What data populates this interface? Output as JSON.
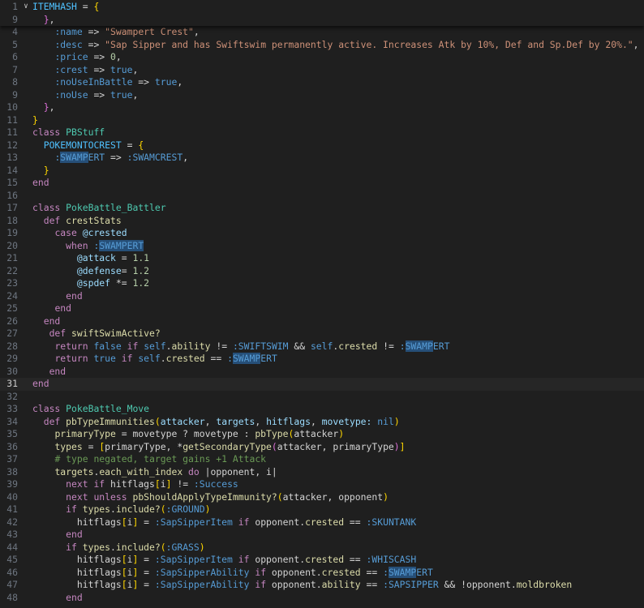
{
  "lines": [
    {
      "num": "1",
      "fold": true,
      "tokens": [
        [
          "t-const",
          "ITEMHASH"
        ],
        [
          "t-op",
          " = "
        ],
        [
          "t-br1",
          "{"
        ]
      ]
    },
    {
      "num": "9",
      "tokens": [
        [
          "t-op",
          "  "
        ],
        [
          "t-br2",
          "}"
        ],
        [
          "t-op",
          ","
        ]
      ]
    },
    {
      "num": "4",
      "tokens": [
        [
          "t-op",
          "    "
        ],
        [
          "t-sym",
          ":name"
        ],
        [
          "t-op",
          " => "
        ],
        [
          "t-str",
          "\"Swampert Crest\""
        ],
        [
          "t-op",
          ","
        ]
      ]
    },
    {
      "num": "5",
      "tokens": [
        [
          "t-op",
          "    "
        ],
        [
          "t-sym",
          ":desc"
        ],
        [
          "t-op",
          " => "
        ],
        [
          "t-str",
          "\"Sap Sipper and has Swiftswim permanently active. Increases Atk by 10%, Def and Sp.Def by 20%.\""
        ],
        [
          "t-op",
          ","
        ]
      ]
    },
    {
      "num": "6",
      "tokens": [
        [
          "t-op",
          "    "
        ],
        [
          "t-sym",
          ":price"
        ],
        [
          "t-op",
          " => "
        ],
        [
          "t-num",
          "0"
        ],
        [
          "t-op",
          ","
        ]
      ]
    },
    {
      "num": "7",
      "tokens": [
        [
          "t-op",
          "    "
        ],
        [
          "t-sym",
          ":crest"
        ],
        [
          "t-op",
          " => "
        ],
        [
          "t-sym",
          "true"
        ],
        [
          "t-op",
          ","
        ]
      ]
    },
    {
      "num": "8",
      "tokens": [
        [
          "t-op",
          "    "
        ],
        [
          "t-sym",
          ":noUseInBattle"
        ],
        [
          "t-op",
          " => "
        ],
        [
          "t-sym",
          "true"
        ],
        [
          "t-op",
          ","
        ]
      ]
    },
    {
      "num": "9",
      "tokens": [
        [
          "t-op",
          "    "
        ],
        [
          "t-sym",
          ":noUse"
        ],
        [
          "t-op",
          " => "
        ],
        [
          "t-sym",
          "true"
        ],
        [
          "t-op",
          ","
        ]
      ]
    },
    {
      "num": "10",
      "tokens": [
        [
          "t-op",
          "  "
        ],
        [
          "t-br2",
          "}"
        ],
        [
          "t-op",
          ","
        ]
      ]
    },
    {
      "num": "11",
      "tokens": [
        [
          "t-br1",
          "}"
        ]
      ]
    },
    {
      "num": "11",
      "tokens": [
        [
          "t-kw",
          "class"
        ],
        [
          "t-op",
          " "
        ],
        [
          "t-cls",
          "PBStuff"
        ]
      ]
    },
    {
      "num": "12",
      "tokens": [
        [
          "t-op",
          "  "
        ],
        [
          "t-const",
          "POKEMONTOCREST"
        ],
        [
          "t-op",
          " = "
        ],
        [
          "t-br1",
          "{"
        ]
      ]
    },
    {
      "num": "13",
      "tokens": [
        [
          "t-op",
          "    "
        ],
        [
          "t-sym",
          ":"
        ],
        [
          "t-sym hl",
          "SWAMP"
        ],
        [
          "t-sym",
          "ERT"
        ],
        [
          "t-op",
          " => "
        ],
        [
          "t-sym",
          ":SWAMCREST"
        ],
        [
          "t-op",
          ","
        ]
      ]
    },
    {
      "num": "14",
      "tokens": [
        [
          "t-op",
          "  "
        ],
        [
          "t-br1",
          "}"
        ]
      ]
    },
    {
      "num": "15",
      "tokens": [
        [
          "t-kw",
          "end"
        ]
      ]
    },
    {
      "num": "16",
      "tokens": []
    },
    {
      "num": "17",
      "tokens": [
        [
          "t-kw",
          "class"
        ],
        [
          "t-op",
          " "
        ],
        [
          "t-cls",
          "PokeBattle_Battler"
        ]
      ]
    },
    {
      "num": "18",
      "tokens": [
        [
          "t-op",
          "  "
        ],
        [
          "t-kw",
          "def"
        ],
        [
          "t-op",
          " "
        ],
        [
          "t-fn",
          "crestStats"
        ]
      ]
    },
    {
      "num": "19",
      "tokens": [
        [
          "t-op",
          "    "
        ],
        [
          "t-ctl",
          "case"
        ],
        [
          "t-op",
          " "
        ],
        [
          "t-var",
          "@crested"
        ]
      ]
    },
    {
      "num": "20",
      "tokens": [
        [
          "t-op",
          "      "
        ],
        [
          "t-ctl",
          "when"
        ],
        [
          "t-op",
          " "
        ],
        [
          "t-sym",
          ":"
        ],
        [
          "t-sym hl",
          "SWAMPERT"
        ]
      ]
    },
    {
      "num": "21",
      "tokens": [
        [
          "t-op",
          "        "
        ],
        [
          "t-var",
          "@attack"
        ],
        [
          "t-op",
          " = "
        ],
        [
          "t-num",
          "1.1"
        ]
      ]
    },
    {
      "num": "22",
      "tokens": [
        [
          "t-op",
          "        "
        ],
        [
          "t-var",
          "@defense"
        ],
        [
          "t-op",
          "= "
        ],
        [
          "t-num",
          "1.2"
        ]
      ]
    },
    {
      "num": "23",
      "tokens": [
        [
          "t-op",
          "        "
        ],
        [
          "t-var",
          "@spdef"
        ],
        [
          "t-op",
          " *= "
        ],
        [
          "t-num",
          "1.2"
        ]
      ]
    },
    {
      "num": "24",
      "tokens": [
        [
          "t-op",
          "      "
        ],
        [
          "t-ctl",
          "end"
        ]
      ]
    },
    {
      "num": "25",
      "tokens": [
        [
          "t-op",
          "    "
        ],
        [
          "t-ctl",
          "end"
        ]
      ]
    },
    {
      "num": "26",
      "tokens": [
        [
          "t-op",
          "  "
        ],
        [
          "t-kw",
          "end"
        ]
      ]
    },
    {
      "num": "27",
      "tokens": [
        [
          "t-op",
          "   "
        ],
        [
          "t-kw",
          "def"
        ],
        [
          "t-op",
          " "
        ],
        [
          "t-fn",
          "swiftSwimActive?"
        ]
      ]
    },
    {
      "num": "28",
      "tokens": [
        [
          "t-op",
          "    "
        ],
        [
          "t-ctl",
          "return"
        ],
        [
          "t-op",
          " "
        ],
        [
          "t-sym",
          "false"
        ],
        [
          "t-op",
          " "
        ],
        [
          "t-ctl",
          "if"
        ],
        [
          "t-op",
          " "
        ],
        [
          "t-self",
          "self"
        ],
        [
          "t-op",
          "."
        ],
        [
          "t-fn",
          "ability"
        ],
        [
          "t-op",
          " != "
        ],
        [
          "t-sym",
          ":SWIFTSWIM"
        ],
        [
          "t-op",
          " && "
        ],
        [
          "t-self",
          "self"
        ],
        [
          "t-op",
          "."
        ],
        [
          "t-fn",
          "crested"
        ],
        [
          "t-op",
          " != "
        ],
        [
          "t-sym",
          ":"
        ],
        [
          "t-sym hl",
          "SWAMP"
        ],
        [
          "t-sym",
          "ERT"
        ]
      ]
    },
    {
      "num": "29",
      "tokens": [
        [
          "t-op",
          "    "
        ],
        [
          "t-ctl",
          "return"
        ],
        [
          "t-op",
          " "
        ],
        [
          "t-sym",
          "true"
        ],
        [
          "t-op",
          " "
        ],
        [
          "t-ctl",
          "if"
        ],
        [
          "t-op",
          " "
        ],
        [
          "t-self",
          "self"
        ],
        [
          "t-op",
          "."
        ],
        [
          "t-fn",
          "crested"
        ],
        [
          "t-op",
          " == "
        ],
        [
          "t-sym",
          ":"
        ],
        [
          "t-sym hl",
          "SWAMP"
        ],
        [
          "t-sym",
          "ERT"
        ]
      ]
    },
    {
      "num": "30",
      "tokens": [
        [
          "t-op",
          "   "
        ],
        [
          "t-kw",
          "end"
        ]
      ]
    },
    {
      "num": "31",
      "current": true,
      "tokens": [
        [
          "t-kw",
          "end"
        ]
      ]
    },
    {
      "num": "32",
      "tokens": []
    },
    {
      "num": "33",
      "tokens": [
        [
          "t-kw",
          "class"
        ],
        [
          "t-op",
          " "
        ],
        [
          "t-cls",
          "PokeBattle_Move"
        ]
      ]
    },
    {
      "num": "34",
      "tokens": [
        [
          "t-op",
          "  "
        ],
        [
          "t-kw",
          "def"
        ],
        [
          "t-op",
          " "
        ],
        [
          "t-fn",
          "pbTypeImmunities"
        ],
        [
          "t-br1",
          "("
        ],
        [
          "t-var",
          "attacker"
        ],
        [
          "t-op",
          ", "
        ],
        [
          "t-var",
          "targets"
        ],
        [
          "t-op",
          ", "
        ],
        [
          "t-var",
          "hitflags"
        ],
        [
          "t-op",
          ", "
        ],
        [
          "t-var",
          "movetype:"
        ],
        [
          "t-op",
          " "
        ],
        [
          "t-sym",
          "nil"
        ],
        [
          "t-br1",
          ")"
        ]
      ]
    },
    {
      "num": "35",
      "tokens": [
        [
          "t-op",
          "    "
        ],
        [
          "t-fn",
          "primaryType"
        ],
        [
          "t-op",
          " = movetype ? movetype : "
        ],
        [
          "t-fn",
          "pbType"
        ],
        [
          "t-br1",
          "("
        ],
        [
          "t-op",
          "attacker"
        ],
        [
          "t-br1",
          ")"
        ]
      ]
    },
    {
      "num": "36",
      "tokens": [
        [
          "t-op",
          "    "
        ],
        [
          "t-fn",
          "types"
        ],
        [
          "t-op",
          " = "
        ],
        [
          "t-br1",
          "["
        ],
        [
          "t-op",
          "primaryType, *"
        ],
        [
          "t-fn",
          "getSecondaryType"
        ],
        [
          "t-br2",
          "("
        ],
        [
          "t-op",
          "attacker, primaryType"
        ],
        [
          "t-br2",
          ")"
        ],
        [
          "t-br1",
          "]"
        ]
      ]
    },
    {
      "num": "37",
      "tokens": [
        [
          "t-op",
          "    "
        ],
        [
          "t-com",
          "# type negated, target gains +1 Attack"
        ]
      ]
    },
    {
      "num": "38",
      "tokens": [
        [
          "t-op",
          "    "
        ],
        [
          "t-fn",
          "targets"
        ],
        [
          "t-op",
          "."
        ],
        [
          "t-fn",
          "each_with_index"
        ],
        [
          "t-op",
          " "
        ],
        [
          "t-ctl",
          "do"
        ],
        [
          "t-op",
          " |opponent, i|"
        ]
      ]
    },
    {
      "num": "39",
      "tokens": [
        [
          "t-op",
          "      "
        ],
        [
          "t-ctl",
          "next"
        ],
        [
          "t-op",
          " "
        ],
        [
          "t-ctl",
          "if"
        ],
        [
          "t-op",
          " hitflags"
        ],
        [
          "t-br1",
          "["
        ],
        [
          "t-op",
          "i"
        ],
        [
          "t-br1",
          "]"
        ],
        [
          "t-op",
          " != "
        ],
        [
          "t-sym",
          ":Success"
        ]
      ]
    },
    {
      "num": "40",
      "tokens": [
        [
          "t-op",
          "      "
        ],
        [
          "t-ctl",
          "next"
        ],
        [
          "t-op",
          " "
        ],
        [
          "t-ctl",
          "unless"
        ],
        [
          "t-op",
          " "
        ],
        [
          "t-fn",
          "pbShouldApplyTypeImmunity?"
        ],
        [
          "t-br1",
          "("
        ],
        [
          "t-op",
          "attacker, opponent"
        ],
        [
          "t-br1",
          ")"
        ]
      ]
    },
    {
      "num": "41",
      "tokens": [
        [
          "t-op",
          "      "
        ],
        [
          "t-ctl",
          "if"
        ],
        [
          "t-op",
          " "
        ],
        [
          "t-fn",
          "types"
        ],
        [
          "t-op",
          "."
        ],
        [
          "t-fn",
          "include?"
        ],
        [
          "t-br1",
          "("
        ],
        [
          "t-sym",
          ":GROUND"
        ],
        [
          "t-br1",
          ")"
        ]
      ]
    },
    {
      "num": "42",
      "tokens": [
        [
          "t-op",
          "        hitflags"
        ],
        [
          "t-br1",
          "["
        ],
        [
          "t-op",
          "i"
        ],
        [
          "t-br1",
          "]"
        ],
        [
          "t-op",
          " = "
        ],
        [
          "t-sym",
          ":SapSipperItem"
        ],
        [
          "t-op",
          " "
        ],
        [
          "t-ctl",
          "if"
        ],
        [
          "t-op",
          " opponent."
        ],
        [
          "t-fn",
          "crested"
        ],
        [
          "t-op",
          " == "
        ],
        [
          "t-sym",
          ":SKUNTANK"
        ]
      ]
    },
    {
      "num": "43",
      "tokens": [
        [
          "t-op",
          "      "
        ],
        [
          "t-ctl",
          "end"
        ]
      ]
    },
    {
      "num": "44",
      "tokens": [
        [
          "t-op",
          "      "
        ],
        [
          "t-ctl",
          "if"
        ],
        [
          "t-op",
          " "
        ],
        [
          "t-fn",
          "types"
        ],
        [
          "t-op",
          "."
        ],
        [
          "t-fn",
          "include?"
        ],
        [
          "t-br1",
          "("
        ],
        [
          "t-sym",
          ":GRASS"
        ],
        [
          "t-br1",
          ")"
        ]
      ]
    },
    {
      "num": "45",
      "tokens": [
        [
          "t-op",
          "        hitflags"
        ],
        [
          "t-br1",
          "["
        ],
        [
          "t-op",
          "i"
        ],
        [
          "t-br1",
          "]"
        ],
        [
          "t-op",
          " = "
        ],
        [
          "t-sym",
          ":SapSipperItem"
        ],
        [
          "t-op",
          " "
        ],
        [
          "t-ctl",
          "if"
        ],
        [
          "t-op",
          " opponent."
        ],
        [
          "t-fn",
          "crested"
        ],
        [
          "t-op",
          " == "
        ],
        [
          "t-sym",
          ":WHISCASH"
        ]
      ]
    },
    {
      "num": "46",
      "tokens": [
        [
          "t-op",
          "        hitflags"
        ],
        [
          "t-br1",
          "["
        ],
        [
          "t-op",
          "i"
        ],
        [
          "t-br1",
          "]"
        ],
        [
          "t-op",
          " = "
        ],
        [
          "t-sym",
          ":SapSipperAbility"
        ],
        [
          "t-op",
          " "
        ],
        [
          "t-ctl",
          "if"
        ],
        [
          "t-op",
          " opponent."
        ],
        [
          "t-fn",
          "crested"
        ],
        [
          "t-op",
          " == "
        ],
        [
          "t-sym",
          ":"
        ],
        [
          "t-sym hl",
          "SWAMP"
        ],
        [
          "t-sym",
          "ERT"
        ]
      ]
    },
    {
      "num": "47",
      "tokens": [
        [
          "t-op",
          "        hitflags"
        ],
        [
          "t-br1",
          "["
        ],
        [
          "t-op",
          "i"
        ],
        [
          "t-br1",
          "]"
        ],
        [
          "t-op",
          " = "
        ],
        [
          "t-sym",
          ":SapSipperAbility"
        ],
        [
          "t-op",
          " "
        ],
        [
          "t-ctl",
          "if"
        ],
        [
          "t-op",
          " opponent."
        ],
        [
          "t-fn",
          "ability"
        ],
        [
          "t-op",
          " == "
        ],
        [
          "t-sym",
          ":SAPSIPPER"
        ],
        [
          "t-op",
          " && !opponent."
        ],
        [
          "t-fn",
          "moldbroken"
        ]
      ]
    },
    {
      "num": "48",
      "tokens": [
        [
          "t-op",
          "      "
        ],
        [
          "t-ctl",
          "end"
        ]
      ]
    }
  ]
}
